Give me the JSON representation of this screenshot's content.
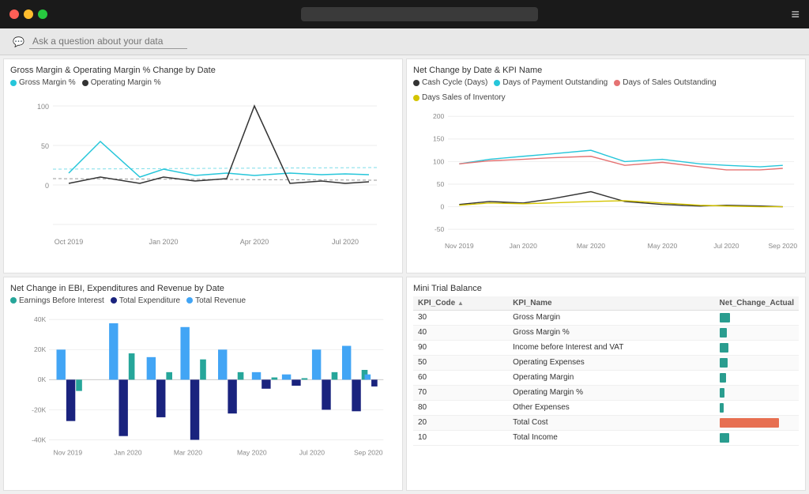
{
  "titlebar": {
    "search_placeholder": "",
    "hamburger": "≡"
  },
  "ask": {
    "icon": "💬",
    "placeholder": "Ask a question about your data"
  },
  "panel1": {
    "title": "Gross Margin & Operating Margin % Change by Date",
    "legend": [
      {
        "label": "Gross Margin %",
        "color": "#26c6da"
      },
      {
        "label": "Operating Margin %",
        "color": "#333"
      }
    ],
    "x_labels": [
      "Oct 2019",
      "Jan 2020",
      "Apr 2020",
      "Jul 2020"
    ],
    "y_labels": [
      "100",
      "50",
      "0"
    ]
  },
  "panel2": {
    "title": "Net Change by Date & KPI Name",
    "legend": [
      {
        "label": "Cash Cycle (Days)",
        "color": "#333"
      },
      {
        "label": "Days of Payment Outstanding",
        "color": "#26c6da"
      },
      {
        "label": "Days of Sales Outstanding",
        "color": "#e57373"
      },
      {
        "label": "Days Sales of Inventory",
        "color": "#d4c400"
      }
    ],
    "x_labels": [
      "Nov 2019",
      "Jan 2020",
      "Mar 2020",
      "May 2020",
      "Jul 2020",
      "Sep 2020"
    ],
    "y_labels": [
      "200",
      "150",
      "100",
      "50",
      "0",
      "-50"
    ]
  },
  "panel3": {
    "title": "Net Change in EBI, Expenditures and Revenue by Date",
    "legend": [
      {
        "label": "Earnings Before Interest",
        "color": "#26a69a"
      },
      {
        "label": "Total Expenditure",
        "color": "#1a237e"
      },
      {
        "label": "Total Revenue",
        "color": "#42a5f5"
      }
    ],
    "x_labels": [
      "Nov 2019",
      "Jan 2020",
      "Mar 2020",
      "May 2020",
      "Jul 2020",
      "Sep 2020"
    ],
    "y_labels": [
      "40K",
      "20K",
      "0K",
      "-20K",
      "-40K"
    ]
  },
  "panel4": {
    "title": "Mini Trial Balance",
    "table": {
      "headers": [
        "KPI_Code",
        "KPI_Name",
        "Net_Change_Actual"
      ],
      "rows": [
        {
          "code": "30",
          "name": "Gross Margin",
          "value": 12,
          "type": "teal"
        },
        {
          "code": "40",
          "name": "Gross Margin %",
          "value": 8,
          "type": "teal"
        },
        {
          "code": "90",
          "name": "Income before Interest and VAT",
          "value": 10,
          "type": "teal"
        },
        {
          "code": "50",
          "name": "Operating Expenses",
          "value": 9,
          "type": "teal"
        },
        {
          "code": "60",
          "name": "Operating Margin",
          "value": 7,
          "type": "teal"
        },
        {
          "code": "70",
          "name": "Operating Margin %",
          "value": 6,
          "type": "teal"
        },
        {
          "code": "80",
          "name": "Other Expenses",
          "value": 5,
          "type": "teal"
        },
        {
          "code": "20",
          "name": "Total Cost",
          "value": 70,
          "type": "red"
        },
        {
          "code": "10",
          "name": "Total Income",
          "value": 11,
          "type": "teal"
        }
      ]
    }
  }
}
